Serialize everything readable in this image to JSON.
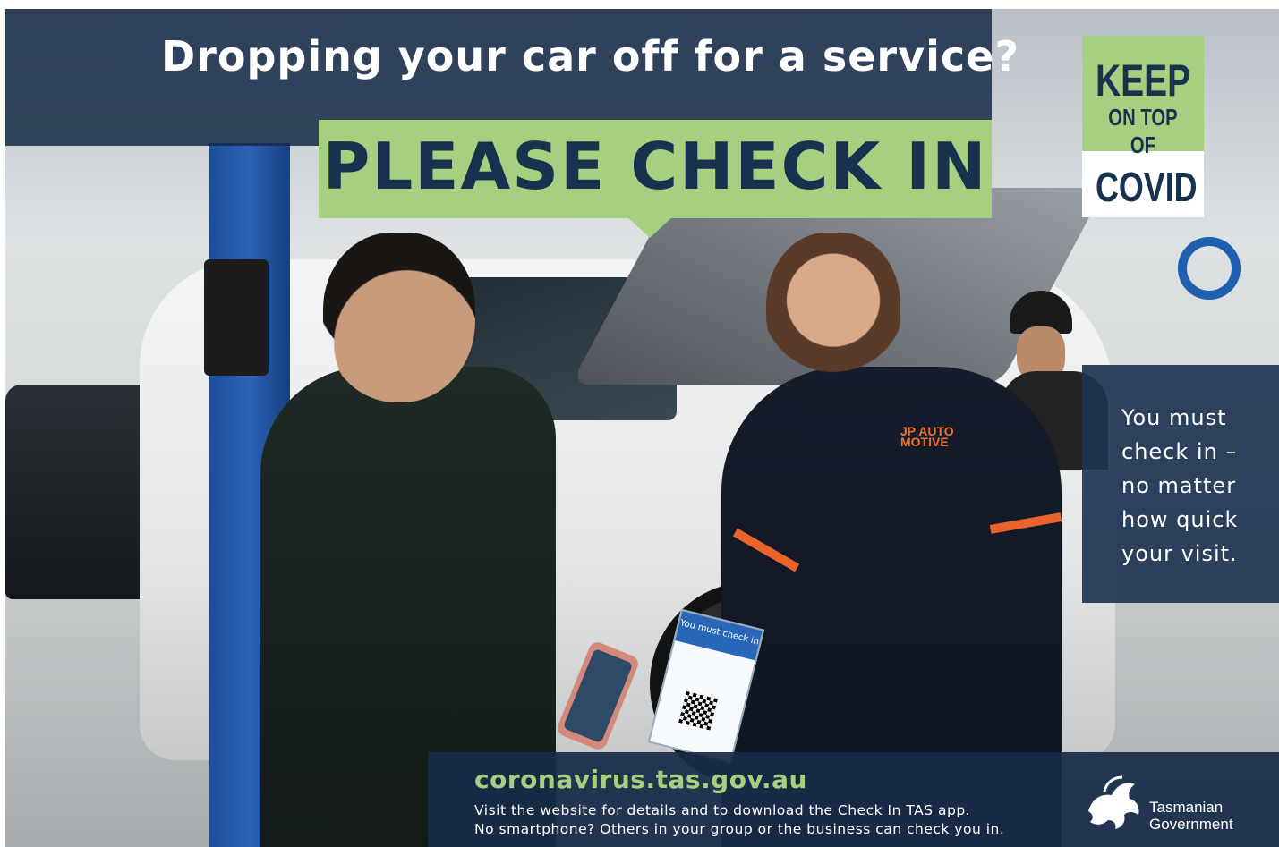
{
  "headline": "Dropping your car off for a service?",
  "cta": "PLEASE CHECK IN",
  "badge": {
    "keep": "KEEP",
    "on_top_of": "ON TOP OF",
    "covid": "COVID"
  },
  "side_message": {
    "line1": "You must",
    "line2": "check in –",
    "line3": "no matter",
    "line4": "how quick",
    "line5": "your visit."
  },
  "footer": {
    "url": "coronavirus.tas.gov.au",
    "line1": "Visit the website for details and to download the Check In TAS app.",
    "line2": "No smartphone? Others in your group or the business can check you in."
  },
  "government": {
    "line1": "Tasmanian",
    "line2": "Government"
  },
  "photo": {
    "mechanic_logo_line1": "JP AUTO",
    "mechanic_logo_line2": "MOTIVE",
    "sign_text": "You must check in"
  },
  "colors": {
    "navy": "#182b48",
    "green": "#a6d07f",
    "text_dark": "#17324f"
  }
}
